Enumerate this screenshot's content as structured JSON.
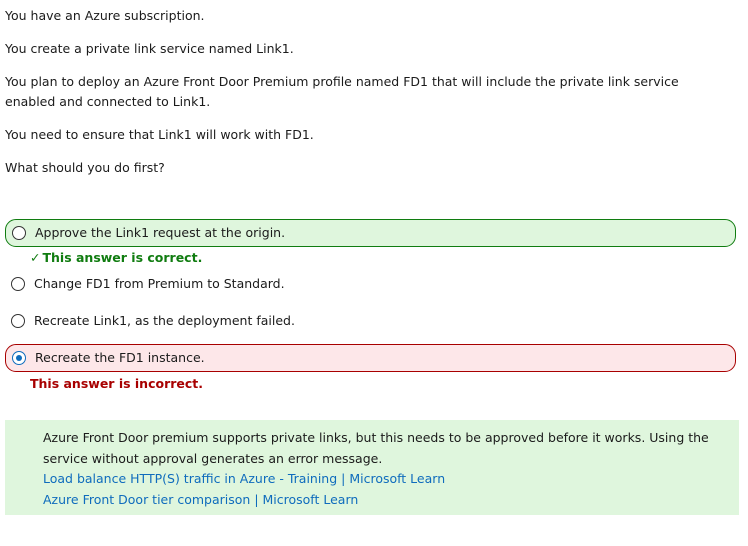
{
  "question": {
    "lines": [
      "You have an Azure subscription.",
      "You create a private link service named Link1.",
      "You plan to deploy an Azure Front Door Premium profile named FD1 that will include the private link service enabled and connected to Link1.",
      "You need to ensure that Link1 will work with FD1.",
      "What should you do first?"
    ]
  },
  "options": [
    {
      "label": "Approve the Link1 request at the origin.",
      "state": "correct",
      "selected": false
    },
    {
      "label": "Change FD1 from Premium to Standard.",
      "state": "neutral",
      "selected": false
    },
    {
      "label": "Recreate Link1, as the deployment failed.",
      "state": "neutral",
      "selected": false
    },
    {
      "label": "Recreate the FD1 instance.",
      "state": "incorrect",
      "selected": true
    }
  ],
  "feedback": {
    "correct": "This answer is correct.",
    "incorrect": "This answer is incorrect.",
    "check_glyph": "✓"
  },
  "explanation": {
    "text": "Azure Front Door premium supports private links, but this needs to be approved before it works. Using the service without approval generates an error message.",
    "links": [
      "Load balance HTTP(S) traffic in Azure - Training | Microsoft Learn",
      "Azure Front Door tier comparison | Microsoft Learn"
    ]
  },
  "colors": {
    "correct": "#107c10",
    "incorrect": "#a80000",
    "link": "#0f6cbd",
    "correct_bg": "#dff6dd",
    "incorrect_bg": "#fde7e9"
  }
}
